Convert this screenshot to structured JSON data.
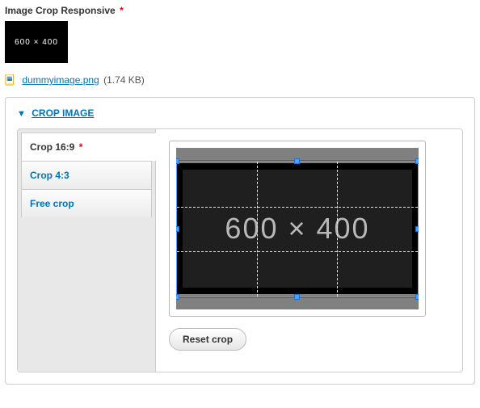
{
  "field": {
    "label": "Image Crop Responsive",
    "required_marker": "*",
    "thumb_text": "600 × 400"
  },
  "file": {
    "name": "dummyimage.png",
    "size": "(1.74 KB)"
  },
  "crop": {
    "section_title": "CROP IMAGE",
    "tabs": {
      "ratio_16_9": {
        "label": "Crop 16:9",
        "required_marker": "*"
      },
      "ratio_4_3": {
        "label": "Crop 4:3"
      },
      "free": {
        "label": "Free crop"
      }
    },
    "preview_text": "600 × 400",
    "reset_label": "Reset crop"
  }
}
